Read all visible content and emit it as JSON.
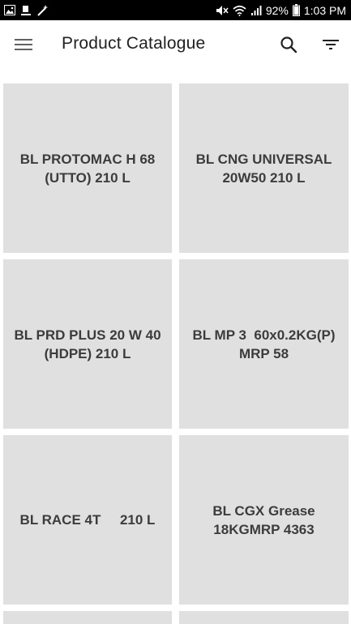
{
  "status_bar": {
    "battery_percent": "92%",
    "time": "1:03 PM"
  },
  "app_bar": {
    "title": "Product Catalogue"
  },
  "products": [
    {
      "name": "BL PROTOMAC H 68 (UTTO) 210 L"
    },
    {
      "name": "BL CNG UNIVERSAL 20W50 210 L"
    },
    {
      "name": "BL PRD PLUS 20 W 40 (HDPE) 210 L"
    },
    {
      "name": "BL MP 3  60x0.2KG(P) MRP 58"
    },
    {
      "name": "BL RACE 4T     210 L"
    },
    {
      "name": "BL CGX Grease 18KGMRP 4363"
    }
  ]
}
